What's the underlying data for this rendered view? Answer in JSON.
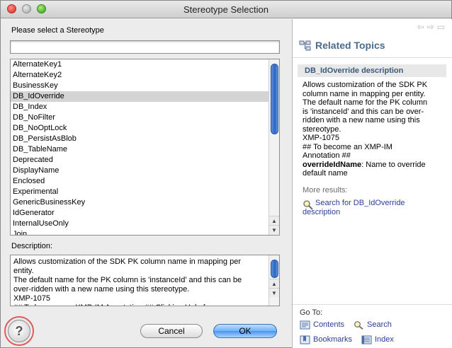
{
  "window": {
    "title": "Stereotype Selection"
  },
  "left": {
    "prompt": "Please select a Stereotype",
    "filter_value": "",
    "items": [
      "AlternateKey1",
      "AlternateKey2",
      "BusinessKey",
      "DB_IdOverride",
      "DB_Index",
      "DB_NoFilter",
      "DB_NoOptLock",
      "DB_PersistAsBlob",
      "DB_TableName",
      "Deprecated",
      "DisplayName",
      "Enclosed",
      "Experimental",
      "GenericBusinessKey",
      "IdGenerator",
      "InternalUseOnly",
      "Join"
    ],
    "selected_index": 3,
    "description_label": "Description:",
    "description_text": "Allows customization of the SDK PK column name in mapping per\nentity.\nThe default name for the PK column is 'instanceId' and this can be\nover-ridden with a new name using this stereotype.\nXMP-1075\n## To become an XMP-IM Annotation ## Clicking Help for"
  },
  "buttons": {
    "cancel": "Cancel",
    "ok": "OK"
  },
  "help": {
    "panel_title": "Related Topics",
    "topic_title": "DB_IdOverride description",
    "topic_lines": [
      "Allows customization of the SDK PK",
      "column name in mapping per entity.",
      "The default name for the PK column",
      "is 'instanceId' and this can be over-",
      "ridden with a new name using this",
      "stereotype.",
      "XMP-1075",
      "## To become an XMP-IM",
      "Annotation ##"
    ],
    "override_label": "overrideIdName",
    "override_text": ": Name to override",
    "override_text2": "default name",
    "more_results": "More results:",
    "search_link_line1": "Search for DB_IdOverride",
    "search_link_line2": "description",
    "goto_label": "Go To:",
    "links": {
      "contents": "Contents",
      "search": "Search",
      "bookmarks": "Bookmarks",
      "index": "Index"
    }
  },
  "colors": {
    "accent": "#2d3d9a",
    "selection": "#d4d4d4",
    "help_ring": "#e05a5a"
  }
}
